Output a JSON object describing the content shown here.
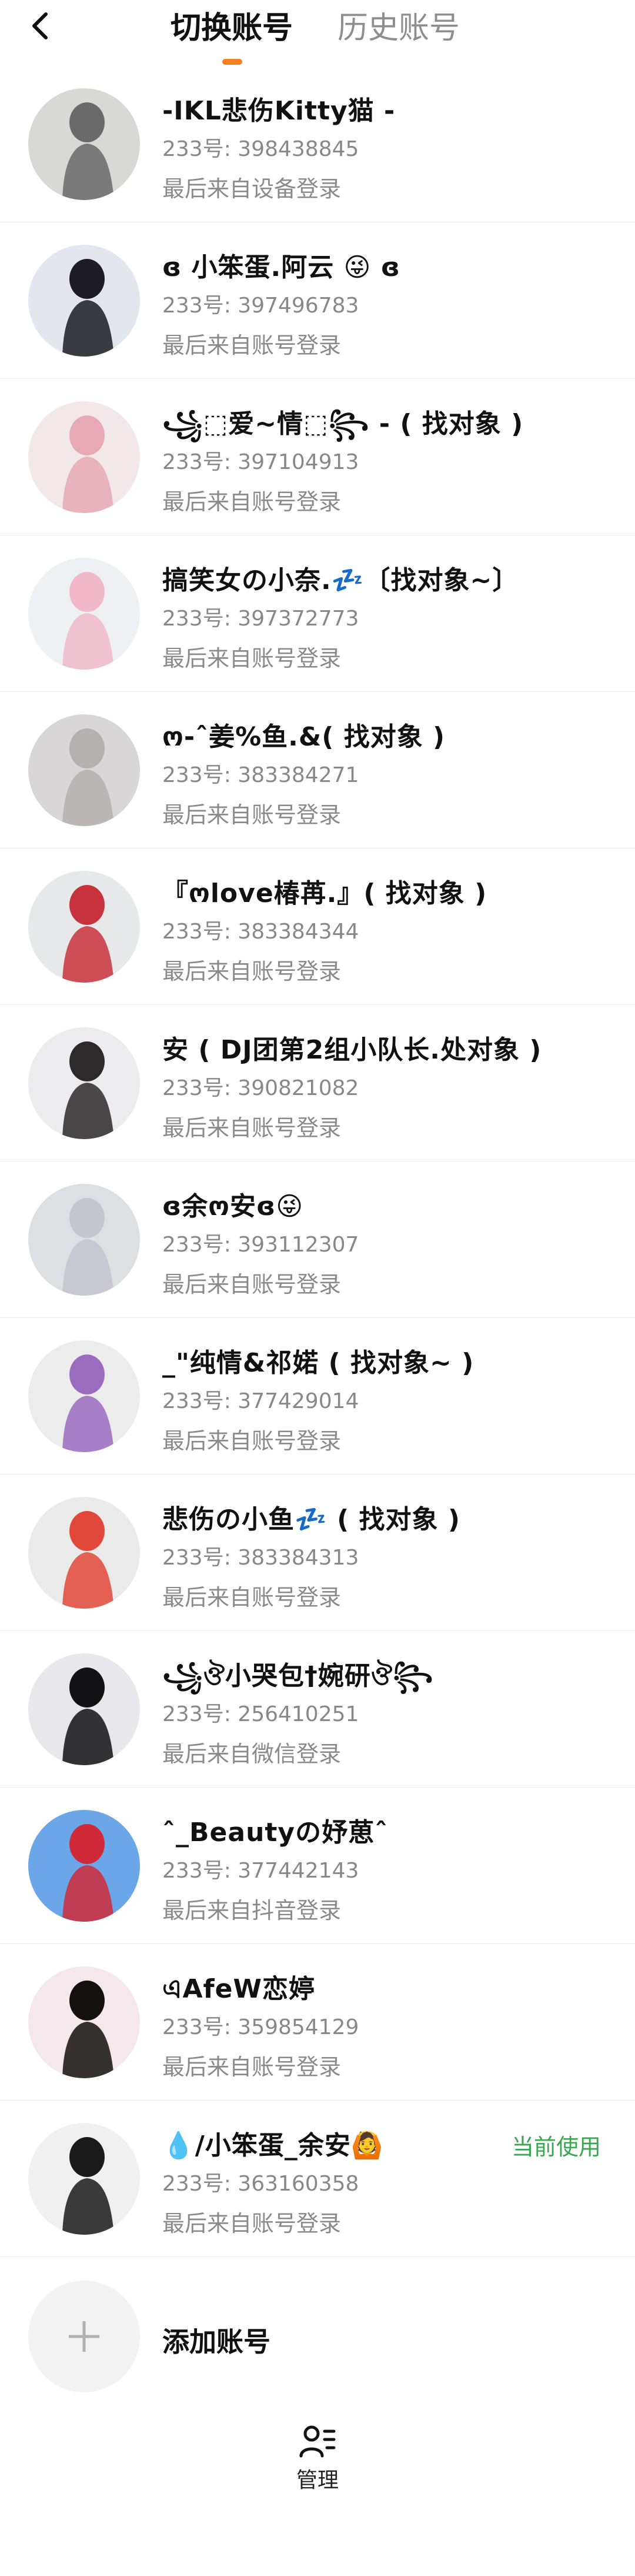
{
  "header": {
    "tab_switch": "切换账号",
    "tab_history": "历史账号"
  },
  "accounts": [
    {
      "name": "-IKL悲伤Kitty猫 -",
      "id": "233号: 398438845",
      "login": "最后来自设备登录",
      "bg": "#d8d8d4",
      "fg": "#6a6a6a"
    },
    {
      "name": "ɞ 小笨蛋.阿云 😜 ɞ",
      "id": "233号: 397496783",
      "login": "最后来自账号登录",
      "bg": "#e4e6ee",
      "fg": "#1c1c22"
    },
    {
      "name": "꧁⬚爱~情⬚꧂ - ( 找对象 )",
      "id": "233号: 397104913",
      "login": "最后来自账号登录",
      "bg": "#f2e8ea",
      "fg": "#e7a9b6"
    },
    {
      "name": "搞笑女の小奈.💤〔找对象~〕",
      "id": "233号: 397372773",
      "login": "最后来自账号登录",
      "bg": "#eef0f4",
      "fg": "#f0b8c8"
    },
    {
      "name": "ო-ˆ姜%鱼.&( 找对象 )",
      "id": "233号: 383384271",
      "login": "最后来自账号登录",
      "bg": "#d8d6d6",
      "fg": "#b4b0ae"
    },
    {
      "name": "『ოlove椿苒.』( 找对象 )",
      "id": "233号: 383384344",
      "login": "最后来自账号登录",
      "bg": "#e6e8ea",
      "fg": "#c8323c"
    },
    {
      "name": "安 ( DJ团第2组小队长.处对象 )",
      "id": "233号: 390821082",
      "login": "最后来自账号登录",
      "bg": "#ecebee",
      "fg": "#2e2a2c"
    },
    {
      "name": "ɞ余ო安ɞ😜",
      "id": "233号: 393112307",
      "login": "最后来自账号登录",
      "bg": "#dedfe3",
      "fg": "#c4c6cc"
    },
    {
      "name": "_\"纯情&祁婼 ( 找对象~ )",
      "id": "233号: 377429014",
      "login": "最后来自账号登录",
      "bg": "#ececec",
      "fg": "#9a6cc0"
    },
    {
      "name": "悲伤の小鱼💤 ( 找对象 )",
      "id": "233号: 383384313",
      "login": "最后来自账号登录",
      "bg": "#eaeaea",
      "fg": "#e2483a"
    },
    {
      "name": "꧁ঔ小哭包†婉研ঔ꧂",
      "id": "233号: 256410251",
      "login": "最后来自微信登录",
      "bg": "#e8e8ec",
      "fg": "#121214"
    },
    {
      "name": "ˆ_Beautyの妤葸ˆ",
      "id": "233号: 377442143",
      "login": "最后来自抖音登录",
      "bg": "#6aa6e8",
      "fg": "#d02a38"
    },
    {
      "name": "এAfeW恋婷",
      "id": "233号: 359854129",
      "login": "最后来自账号登录",
      "bg": "#f4e8ec",
      "fg": "#141010"
    },
    {
      "name": "💧/小笨蛋_余安🙆",
      "id": "233号: 363160358",
      "login": "最后来自账号登录",
      "bg": "#f0f0f0",
      "fg": "#1a1a1a",
      "current": "当前使用"
    }
  ],
  "add_account": {
    "label": "添加账号"
  },
  "footer": {
    "manage_label": "管理"
  },
  "colors": {
    "accent": "#f58220",
    "current": "#3aa650"
  },
  "icons": {
    "back": "chevron-left-icon",
    "add": "plus-icon",
    "manage": "user-list-icon"
  }
}
